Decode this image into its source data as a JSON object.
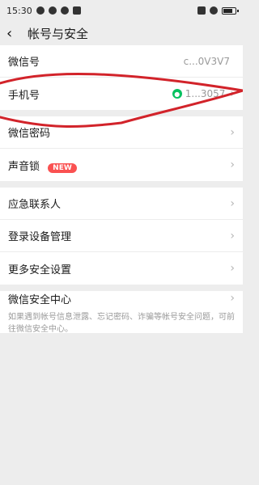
{
  "status_bar": {
    "time": "15:30"
  },
  "header": {
    "title": "帐号与安全"
  },
  "account": {
    "wechat_id_label": "微信号",
    "wechat_id_value": "c...0V3V7",
    "phone_label": "手机号",
    "phone_value": "1...3057"
  },
  "security": {
    "password_label": "微信密码",
    "voice_lock_label": "声音锁",
    "new_badge": "NEW"
  },
  "more": {
    "emergency_label": "应急联系人",
    "devices_label": "登录设备管理",
    "more_security_label": "更多安全设置"
  },
  "center": {
    "title": "微信安全中心",
    "desc": "如果遇到帐号信息泄露、忘记密码、诈骗等帐号安全问题，可前往微信安全中心。"
  },
  "colors": {
    "accent_green": "#07c160",
    "badge_red": "#fa5151",
    "scribble_red": "#d2232a"
  }
}
